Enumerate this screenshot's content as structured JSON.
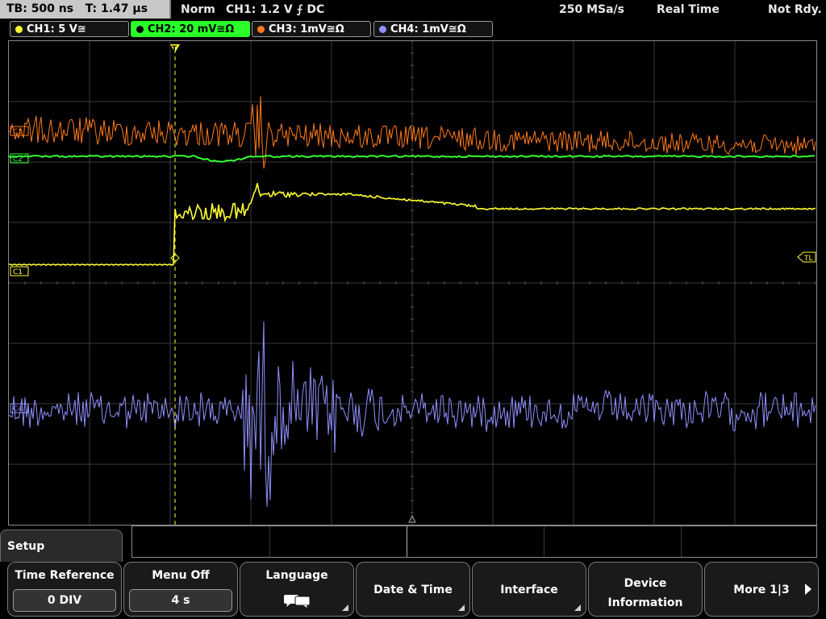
{
  "top": {
    "timebase": "TB: 500 ns",
    "trigger_time": "T: 1.47 μs",
    "mode": "Norm",
    "trigger_source": "CH1: 1.2 V ⨍ DC",
    "sample_rate": "250 MSa/s",
    "acq_mode": "Real Time",
    "status": "Not Rdy."
  },
  "channels": [
    {
      "label": "CH1: 5 V≅",
      "color": "#ffff33"
    },
    {
      "label": "CH2: 20 mV≅Ω",
      "color": "#33ff33"
    },
    {
      "label": "CH3: 1mV≅Ω",
      "color": "#ff7a1a"
    },
    {
      "label": "CH4: 1mV≅Ω",
      "color": "#9090ff"
    }
  ],
  "markers": {
    "c3": "C3",
    "c2": "C2",
    "c1": "C1",
    "c4": "C4",
    "trigger_level": "TL"
  },
  "colors": {
    "ch1": "#ffff33",
    "ch2": "#33ff33",
    "ch3": "#ff7a1a",
    "ch4": "#9090ff",
    "grid": "#3a3a3a"
  },
  "menu": {
    "title": "Setup",
    "softkeys": [
      {
        "label": "Time Reference",
        "value": "0 DIV"
      },
      {
        "label": "Menu Off",
        "value": "4 s"
      },
      {
        "label": "Language",
        "icon": "speech-bubbles-icon"
      },
      {
        "label": "Date & Time"
      },
      {
        "label": "Interface"
      },
      {
        "label": "Device",
        "label2": "Information"
      },
      {
        "label": "More 1|3"
      }
    ]
  }
}
